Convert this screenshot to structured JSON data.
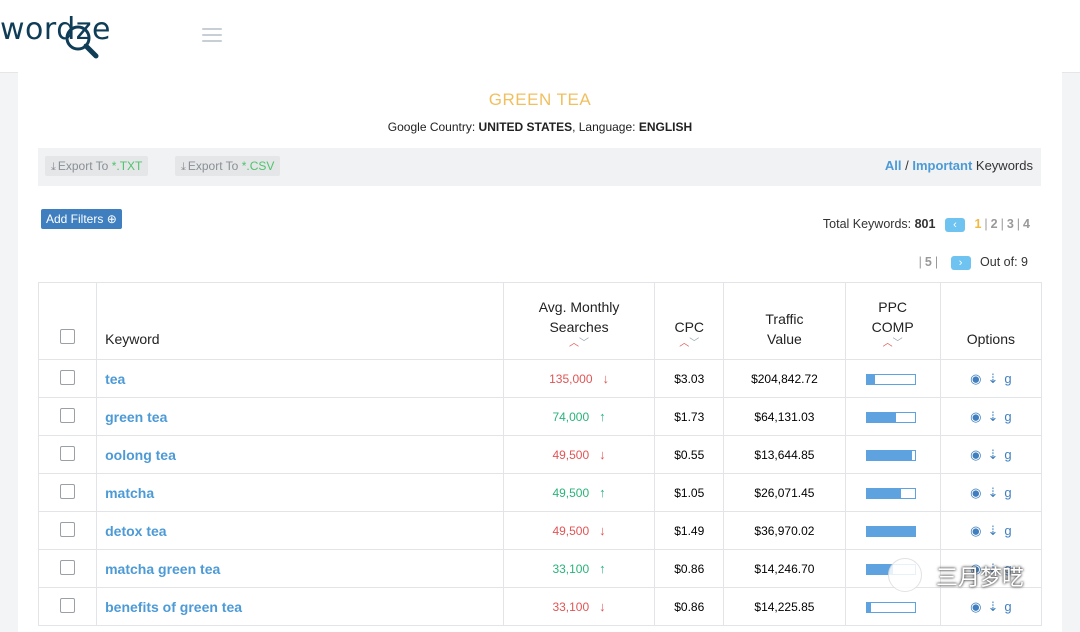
{
  "header": {
    "logo_text": "wordze"
  },
  "report": {
    "title": "GREEN TEA",
    "country_label": "Google Country:",
    "country": "UNITED STATES",
    "language_label": ", Language:",
    "language": "ENGLISH"
  },
  "export": {
    "txt_prefix": "Export To ",
    "txt_ext": "*.TXT",
    "csv_prefix": "Export To ",
    "csv_ext": "*.CSV"
  },
  "keyword_filter": {
    "all": "All",
    "slash": " / ",
    "important": "Important",
    "suffix": " Keywords"
  },
  "filters": {
    "add_label": "Add Filters"
  },
  "pagination": {
    "total_label": "Total Keywords:",
    "total": "801",
    "pages": [
      "1",
      "2",
      "3",
      "4",
      "5"
    ],
    "current": "1",
    "out_of_label": "Out of:",
    "out_of": "9"
  },
  "table": {
    "headers": {
      "keyword": "Keyword",
      "avg_line1": "Avg. Monthly",
      "avg_line2": "Searches",
      "cpc": "CPC",
      "traffic_line1": "Traffic",
      "traffic_line2": "Value",
      "ppc_line1": "PPC",
      "ppc_line2": "COMP",
      "options": "Options"
    },
    "rows": [
      {
        "keyword": "tea",
        "searches": "135,000",
        "trend": "down",
        "cpc": "$3.03",
        "traffic": "$204,842.72",
        "ppc": 0.18
      },
      {
        "keyword": "green tea",
        "searches": "74,000",
        "trend": "up",
        "cpc": "$1.73",
        "traffic": "$64,131.03",
        "ppc": 0.62
      },
      {
        "keyword": "oolong tea",
        "searches": "49,500",
        "trend": "down",
        "cpc": "$0.55",
        "traffic": "$13,644.85",
        "ppc": 0.94
      },
      {
        "keyword": "matcha",
        "searches": "49,500",
        "trend": "up",
        "cpc": "$1.05",
        "traffic": "$26,071.45",
        "ppc": 0.72
      },
      {
        "keyword": "detox tea",
        "searches": "49,500",
        "trend": "down",
        "cpc": "$1.49",
        "traffic": "$36,970.02",
        "ppc": 1.0
      },
      {
        "keyword": "matcha green tea",
        "searches": "33,100",
        "trend": "up",
        "cpc": "$0.86",
        "traffic": "$14,246.70",
        "ppc": 0.55
      },
      {
        "keyword": "benefits of green tea",
        "searches": "33,100",
        "trend": "down",
        "cpc": "$0.86",
        "traffic": "$14,225.85",
        "ppc": 0.1
      }
    ]
  },
  "colors": {
    "accent": "#4c9ad6",
    "title": "#f0c060",
    "up": "#2ab27b",
    "down": "#e05555",
    "button": "#3f7fc0"
  },
  "watermark": {
    "text": "三月梦呓"
  }
}
